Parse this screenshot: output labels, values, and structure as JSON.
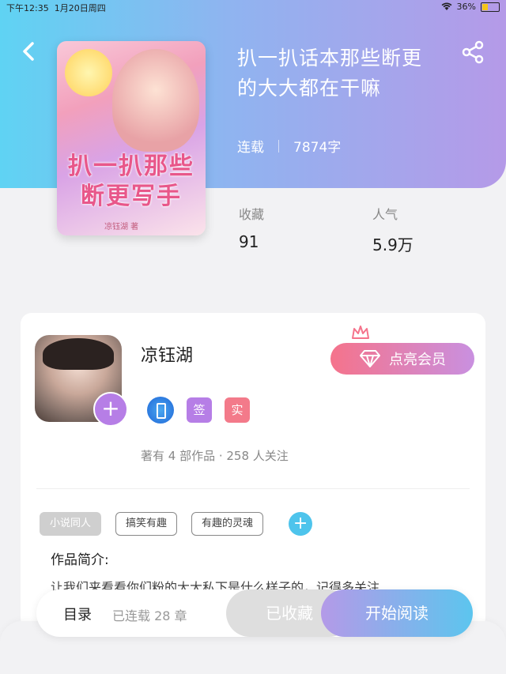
{
  "status_bar": {
    "time": "下午12:35",
    "date": "1月20日周四",
    "battery": "36%"
  },
  "book": {
    "title_line1": "扒一扒话本那些断更",
    "title_line2": "的大大都在干嘛",
    "status": "连载",
    "word_count": "7874字",
    "cover_title_line1": "扒一扒那些",
    "cover_title_line2": "断更写手",
    "cover_author": "凉钰湖 著"
  },
  "stats": {
    "favorites_label": "收藏",
    "favorites_value": "91",
    "popularity_label": "人气",
    "popularity_value": "5.9万"
  },
  "author": {
    "name": "凉钰湖",
    "badge_sign": "签",
    "badge_real": "实",
    "summary": "著有 4 部作品 · 258 人关注",
    "vip_button": "点亮会员"
  },
  "tags": [
    "小说同人",
    "搞笑有趣",
    "有趣的灵魂"
  ],
  "intro": {
    "title": "作品简介:",
    "text": "让我们来看看你们粉的大大私下是什么样子的，记得多关注"
  },
  "bottom_bar": {
    "toc": "目录",
    "chapters": "已连载 28 章",
    "collected": "已收藏",
    "read": "开始阅读"
  },
  "colors": {
    "accent_blue": "#5fd3f3",
    "accent_purple": "#b59ae8",
    "vip_pink": "#f5738b",
    "sign_badge": "#b67ee6",
    "real_badge": "#f37a8a",
    "tag_add": "#4ec4ec"
  },
  "icons": [
    "back-icon",
    "share-icon",
    "plus-icon",
    "diamond-icon",
    "crown-icon",
    "wifi-icon",
    "battery-icon"
  ]
}
